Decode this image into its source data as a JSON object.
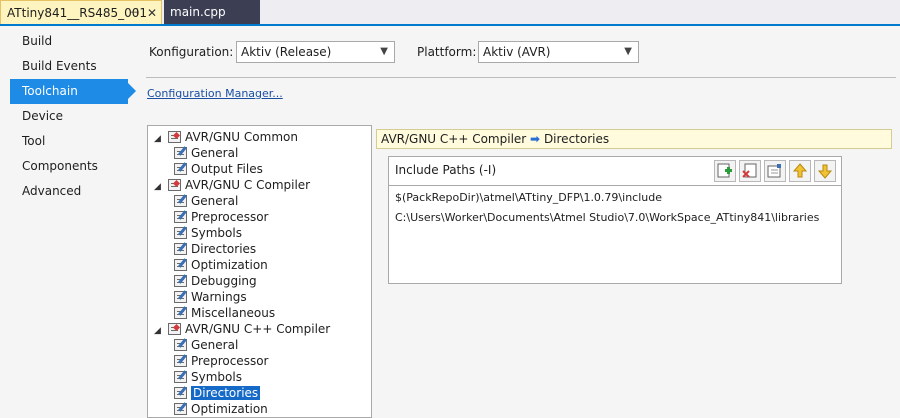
{
  "tabs": [
    {
      "label": "ATtiny841__RS485_001",
      "pin": "⊣",
      "close": "✕"
    },
    {
      "label": "main.cpp"
    }
  ],
  "nav": {
    "items": [
      "Build",
      "Build Events",
      "Toolchain",
      "Device",
      "Tool",
      "Components",
      "Advanced"
    ],
    "selected": "Toolchain"
  },
  "config": {
    "konfiguration_label": "Konfiguration:",
    "konfiguration_value": "Aktiv (Release)",
    "plattform_label": "Plattform:",
    "plattform_value": "Aktiv (AVR)",
    "manager_link": "Configuration Manager..."
  },
  "tree": {
    "rows": [
      {
        "text": "AVR/GNU Common",
        "level": 0,
        "expander": "◢",
        "icon": "red"
      },
      {
        "text": "General",
        "level": 1,
        "icon": "pen"
      },
      {
        "text": "Output Files",
        "level": 1,
        "icon": "pen"
      },
      {
        "text": "AVR/GNU C Compiler",
        "level": 0,
        "expander": "◢",
        "icon": "red"
      },
      {
        "text": "General",
        "level": 1,
        "icon": "pen"
      },
      {
        "text": "Preprocessor",
        "level": 1,
        "icon": "pen"
      },
      {
        "text": "Symbols",
        "level": 1,
        "icon": "pen"
      },
      {
        "text": "Directories",
        "level": 1,
        "icon": "pen"
      },
      {
        "text": "Optimization",
        "level": 1,
        "icon": "pen"
      },
      {
        "text": "Debugging",
        "level": 1,
        "icon": "pen"
      },
      {
        "text": "Warnings",
        "level": 1,
        "icon": "pen"
      },
      {
        "text": "Miscellaneous",
        "level": 1,
        "icon": "pen"
      },
      {
        "text": "AVR/GNU C++ Compiler",
        "level": 0,
        "expander": "◢",
        "icon": "red"
      },
      {
        "text": "General",
        "level": 1,
        "icon": "pen"
      },
      {
        "text": "Preprocessor",
        "level": 1,
        "icon": "pen"
      },
      {
        "text": "Symbols",
        "level": 1,
        "icon": "pen"
      },
      {
        "text": "Directories",
        "level": 1,
        "icon": "pen",
        "selected": true
      },
      {
        "text": "Optimization",
        "level": 1,
        "icon": "pen"
      }
    ]
  },
  "breadcrumb": {
    "parent": "AVR/GNU C++ Compiler",
    "arrow": "➡",
    "current": "Directories"
  },
  "include_paths": {
    "title": "Include Paths (-I)",
    "buttons": [
      "add-item-icon",
      "delete-item-icon",
      "edit-item-icon",
      "move-up-icon",
      "move-down-icon"
    ],
    "paths": [
      "$(PackRepoDir)\\atmel\\ATtiny_DFP\\1.0.79\\include",
      "C:\\Users\\Worker\\Documents\\Atmel Studio\\7.0\\WorkSpace_ATtiny841\\libraries"
    ]
  }
}
